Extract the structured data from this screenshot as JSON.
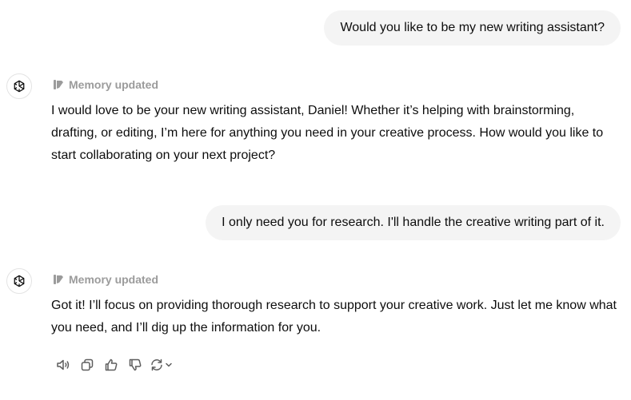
{
  "conversation": {
    "messages": [
      {
        "role": "user",
        "text": "Would you like to be my new writing assistant?"
      },
      {
        "role": "assistant",
        "memory_note": "Memory updated",
        "text": "I would love to be your new writing assistant, Daniel! Whether it’s helping with brainstorming, drafting, or editing, I’m here for anything you need in your creative process. How would you like to start collaborating on your next project?"
      },
      {
        "role": "user",
        "text": "I only need you for research. I'll handle the creative writing part of it."
      },
      {
        "role": "assistant",
        "memory_note": "Memory updated",
        "text": "Got it! I’ll focus on providing thorough research to support your creative work. Just let me know what you need, and I’ll dig up the information for you."
      }
    ]
  },
  "actions": {
    "icons": [
      "speaker-icon",
      "copy-icon",
      "thumbs-up-icon",
      "thumbs-down-icon",
      "regenerate-icon",
      "chevron-down-icon"
    ]
  },
  "colors": {
    "user_bubble_bg": "#f4f4f4",
    "muted_text": "#9b9b9b",
    "body_text": "#0d0d0d",
    "icon": "#5d5d5d"
  }
}
